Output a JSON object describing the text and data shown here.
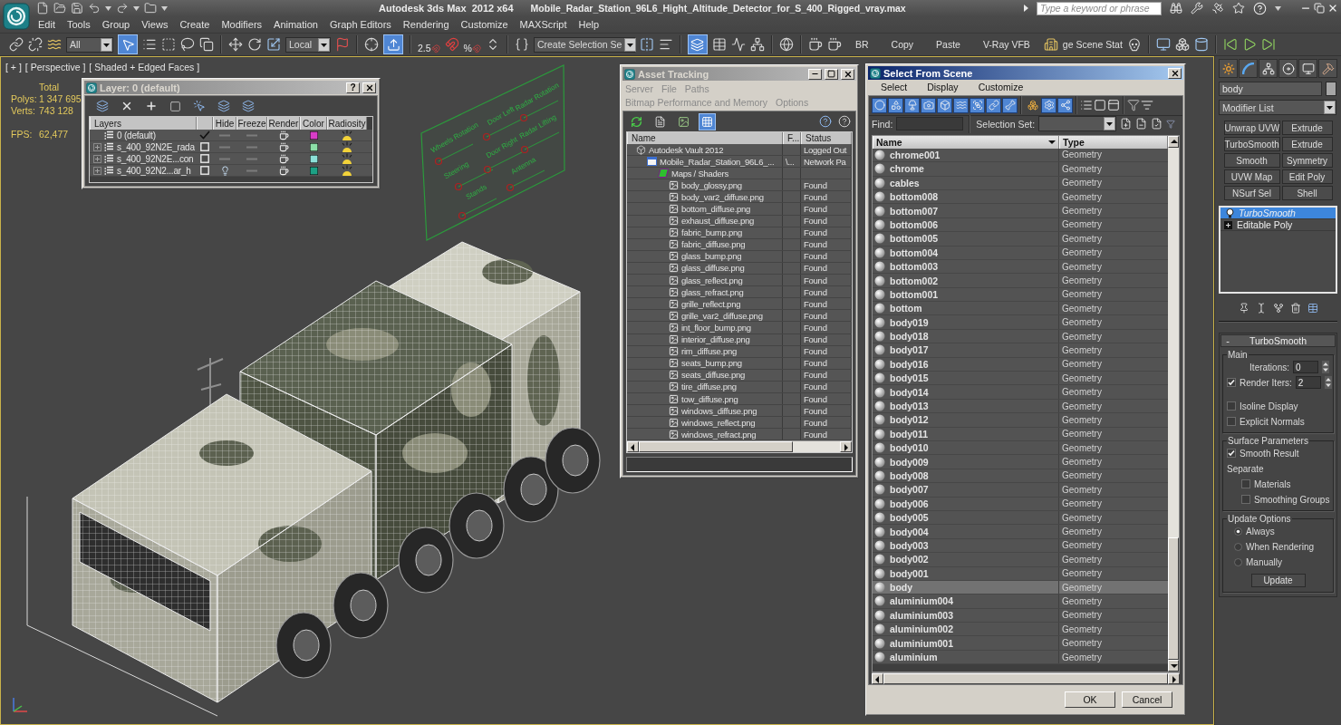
{
  "title_bar": {
    "app_title": "Autodesk 3ds Max  2012 x64",
    "file_name": "Mobile_Radar_Station_96L6_Hight_Altitude_Detector_for_S_400_Rigged_vray.max",
    "search": {
      "placeholder": "Type a keyword or phrase"
    }
  },
  "menu_bar": [
    "Edit",
    "Tools",
    "Group",
    "Views",
    "Create",
    "Modifiers",
    "Animation",
    "Graph Editors",
    "Rendering",
    "Customize",
    "MAXScript",
    "Help"
  ],
  "main_toolbar": {
    "selection_filter": "All",
    "select_object_on": true,
    "reference_coordinate": "Local",
    "keyboard_override_on": true,
    "snap_label": "2.5",
    "percent_snap_label": "%",
    "named_selection_set": "Create Selection Se",
    "layer_manager_on": true,
    "commands": [
      "BR",
      "Copy",
      "Paste",
      "V-Ray VFB"
    ],
    "scene_states": "ge Scene Stat"
  },
  "viewport": {
    "labels": [
      "[ + ]",
      "[ Perspective ]",
      "[ Shaded + Edged Faces ]"
    ],
    "stats_heading": "Total",
    "stats": [
      {
        "label": "Polys:",
        "value": "1 347 695"
      },
      {
        "label": "Verts:",
        "value": "743 128"
      }
    ],
    "fps": {
      "label": "FPS:",
      "value": "62,477"
    },
    "rig_controls": [
      {
        "label": "Wheels Rotation",
        "level": 0
      },
      {
        "label": "Door Left",
        "level": 0
      },
      {
        "label": "Radar Rotation",
        "level": 0
      },
      {
        "label": "Steering",
        "level": 0
      },
      {
        "label": "Door Right",
        "level": 0
      },
      {
        "label": "Radar Lifting",
        "level": 0
      },
      {
        "label": "Stands",
        "level": 0
      },
      {
        "label": "Antenna",
        "level": 0
      }
    ]
  },
  "layer_dialog": {
    "title": "Layer: 0 (default)",
    "active": false,
    "help": "?",
    "columns": [
      "Layers",
      "Hide",
      "Freeze",
      "Render",
      "Color",
      "Radiosity"
    ],
    "layers": [
      {
        "name": "0 (default)",
        "current": true,
        "hidden": false,
        "frozen": false,
        "renderable": true,
        "color": "#d83cc8"
      },
      {
        "name": "s_400_92N2E_rada",
        "expanded": false,
        "current": false,
        "hidden": false,
        "frozen": false,
        "renderable": true,
        "color": "#8ce0a8"
      },
      {
        "name": "s_400_92N2E...con",
        "expanded": false,
        "current": false,
        "hidden": false,
        "frozen": false,
        "renderable": true,
        "color": "#8ce0d8"
      },
      {
        "name": "s_400_92N2...ar_h",
        "expanded": false,
        "current": false,
        "hidden": true,
        "frozen": false,
        "renderable": true,
        "color": "#1ca084"
      }
    ]
  },
  "asset_tracking": {
    "title": "Asset Tracking",
    "active": false,
    "menus": [
      "Server",
      "File",
      "Paths",
      "Bitmap Performance and Memory",
      "Options"
    ],
    "views": [
      {
        "selected": false
      },
      {
        "selected": false
      },
      {
        "selected": false
      },
      {
        "selected": true
      }
    ],
    "columns": [
      "Name",
      "F...",
      "Status"
    ],
    "tree": [
      {
        "kind": "vault",
        "name": "Autodesk Vault 2012",
        "status": "Logged Out",
        "children": [
          {
            "kind": "scene",
            "name": "Mobile_Radar_Station_96L6_...",
            "path": "\\...",
            "status": "Network Pa",
            "children": [
              {
                "kind": "folder",
                "name": "Maps / Shaders",
                "children": [
                  {
                    "kind": "bitmap",
                    "name": "body_glossy.png",
                    "status": "Found"
                  },
                  {
                    "kind": "bitmap",
                    "name": "body_var2_diffuse.png",
                    "status": "Found"
                  },
                  {
                    "kind": "bitmap",
                    "name": "bottom_diffuse.png",
                    "status": "Found"
                  },
                  {
                    "kind": "bitmap",
                    "name": "exhaust_diffuse.png",
                    "status": "Found"
                  },
                  {
                    "kind": "bitmap",
                    "name": "fabric_bump.png",
                    "status": "Found"
                  },
                  {
                    "kind": "bitmap",
                    "name": "fabric_diffuse.png",
                    "status": "Found"
                  },
                  {
                    "kind": "bitmap",
                    "name": "glass_bump.png",
                    "status": "Found"
                  },
                  {
                    "kind": "bitmap",
                    "name": "glass_diffuse.png",
                    "status": "Found"
                  },
                  {
                    "kind": "bitmap",
                    "name": "glass_reflect.png",
                    "status": "Found"
                  },
                  {
                    "kind": "bitmap",
                    "name": "glass_refract.png",
                    "status": "Found"
                  },
                  {
                    "kind": "bitmap",
                    "name": "grille_reflect.png",
                    "status": "Found"
                  },
                  {
                    "kind": "bitmap",
                    "name": "grille_var2_diffuse.png",
                    "status": "Found"
                  },
                  {
                    "kind": "bitmap",
                    "name": "int_floor_bump.png",
                    "status": "Found"
                  },
                  {
                    "kind": "bitmap",
                    "name": "interior_diffuse.png",
                    "status": "Found"
                  },
                  {
                    "kind": "bitmap",
                    "name": "rim_diffuse.png",
                    "status": "Found"
                  },
                  {
                    "kind": "bitmap",
                    "name": "seats_bump.png",
                    "status": "Found"
                  },
                  {
                    "kind": "bitmap",
                    "name": "seats_diffuse.png",
                    "status": "Found"
                  },
                  {
                    "kind": "bitmap",
                    "name": "tire_diffuse.png",
                    "status": "Found"
                  },
                  {
                    "kind": "bitmap",
                    "name": "tow_diffuse.png",
                    "status": "Found"
                  },
                  {
                    "kind": "bitmap",
                    "name": "windows_diffuse.png",
                    "status": "Found"
                  },
                  {
                    "kind": "bitmap",
                    "name": "windows_reflect.png",
                    "status": "Found"
                  },
                  {
                    "kind": "bitmap",
                    "name": "windows_refract.png",
                    "status": "Found"
                  }
                ]
              }
            ]
          }
        ]
      }
    ]
  },
  "select_from_scene": {
    "title": "Select From Scene",
    "active": true,
    "menus": [
      "Select",
      "Display",
      "Customize"
    ],
    "type_filters": [
      {
        "on": true
      },
      {
        "on": true
      },
      {
        "on": true
      },
      {
        "on": true
      },
      {
        "on": true
      },
      {
        "on": true
      },
      {
        "on": true
      },
      {
        "on": true
      },
      {
        "on": true
      }
    ],
    "option_toggles": [
      {
        "on": false
      },
      {
        "on": true
      },
      {
        "on": true
      }
    ],
    "find_label": "Find:",
    "selection_set_label": "Selection Set:",
    "columns": [
      "Name",
      "Type"
    ],
    "rows": [
      {
        "name": "chrome001",
        "type": "Geometry",
        "selected": false
      },
      {
        "name": "chrome",
        "type": "Geometry",
        "selected": false
      },
      {
        "name": "cables",
        "type": "Geometry",
        "selected": false
      },
      {
        "name": "bottom008",
        "type": "Geometry",
        "selected": false
      },
      {
        "name": "bottom007",
        "type": "Geometry",
        "selected": false
      },
      {
        "name": "bottom006",
        "type": "Geometry",
        "selected": false
      },
      {
        "name": "bottom005",
        "type": "Geometry",
        "selected": false
      },
      {
        "name": "bottom004",
        "type": "Geometry",
        "selected": false
      },
      {
        "name": "bottom003",
        "type": "Geometry",
        "selected": false
      },
      {
        "name": "bottom002",
        "type": "Geometry",
        "selected": false
      },
      {
        "name": "bottom001",
        "type": "Geometry",
        "selected": false
      },
      {
        "name": "bottom",
        "type": "Geometry",
        "selected": false
      },
      {
        "name": "body019",
        "type": "Geometry",
        "selected": false
      },
      {
        "name": "body018",
        "type": "Geometry",
        "selected": false
      },
      {
        "name": "body017",
        "type": "Geometry",
        "selected": false
      },
      {
        "name": "body016",
        "type": "Geometry",
        "selected": false
      },
      {
        "name": "body015",
        "type": "Geometry",
        "selected": false
      },
      {
        "name": "body014",
        "type": "Geometry",
        "selected": false
      },
      {
        "name": "body013",
        "type": "Geometry",
        "selected": false
      },
      {
        "name": "body012",
        "type": "Geometry",
        "selected": false
      },
      {
        "name": "body011",
        "type": "Geometry",
        "selected": false
      },
      {
        "name": "body010",
        "type": "Geometry",
        "selected": false
      },
      {
        "name": "body009",
        "type": "Geometry",
        "selected": false
      },
      {
        "name": "body008",
        "type": "Geometry",
        "selected": false
      },
      {
        "name": "body007",
        "type": "Geometry",
        "selected": false
      },
      {
        "name": "body006",
        "type": "Geometry",
        "selected": false
      },
      {
        "name": "body005",
        "type": "Geometry",
        "selected": false
      },
      {
        "name": "body004",
        "type": "Geometry",
        "selected": false
      },
      {
        "name": "body003",
        "type": "Geometry",
        "selected": false
      },
      {
        "name": "body002",
        "type": "Geometry",
        "selected": false
      },
      {
        "name": "body001",
        "type": "Geometry",
        "selected": false
      },
      {
        "name": "body",
        "type": "Geometry",
        "selected": true
      },
      {
        "name": "aluminium004",
        "type": "Geometry",
        "selected": false
      },
      {
        "name": "aluminium003",
        "type": "Geometry",
        "selected": false
      },
      {
        "name": "aluminium002",
        "type": "Geometry",
        "selected": false
      },
      {
        "name": "aluminium001",
        "type": "Geometry",
        "selected": false
      },
      {
        "name": "aluminium",
        "type": "Geometry",
        "selected": false
      }
    ],
    "buttons": [
      "OK",
      "Cancel"
    ]
  },
  "command_panel": {
    "object_name": "body",
    "modifier_list": "Modifier List",
    "modifier_buttons": [
      "Unwrap UVW",
      "Extrude",
      "TurboSmooth",
      "Extrude",
      "Smooth",
      "Symmetry",
      "UVW Map",
      "Edit Poly",
      "NSurf Sel",
      "Shell"
    ],
    "stack": [
      {
        "label": "TurboSmooth",
        "kind": "modifier",
        "on": true,
        "selected": true
      },
      {
        "label": "Editable Poly",
        "kind": "base",
        "expanded": false,
        "selected": false
      }
    ],
    "rollout": {
      "collapse": "-",
      "title": "TurboSmooth",
      "main": {
        "title": "Main",
        "iterations_label": "Iterations:",
        "iterations": "0",
        "render_iters": {
          "label": "Render Iters:",
          "checked": true,
          "value": "2"
        },
        "options": [
          {
            "label": "Isoline Display",
            "checked": false
          },
          {
            "label": "Explicit Normals",
            "checked": false
          }
        ]
      },
      "surface": {
        "title": "Surface Parameters",
        "smooth_result": {
          "label": "Smooth Result",
          "checked": true
        },
        "separate_label": "Separate",
        "separate": [
          {
            "label": "Materials",
            "checked": false
          },
          {
            "label": "Smoothing Groups",
            "checked": false
          }
        ]
      },
      "update": {
        "title": "Update Options",
        "options": [
          {
            "label": "Always",
            "selected": true
          },
          {
            "label": "When Rendering",
            "selected": false
          },
          {
            "label": "Manually",
            "selected": false
          }
        ],
        "button": "Update"
      }
    }
  }
}
